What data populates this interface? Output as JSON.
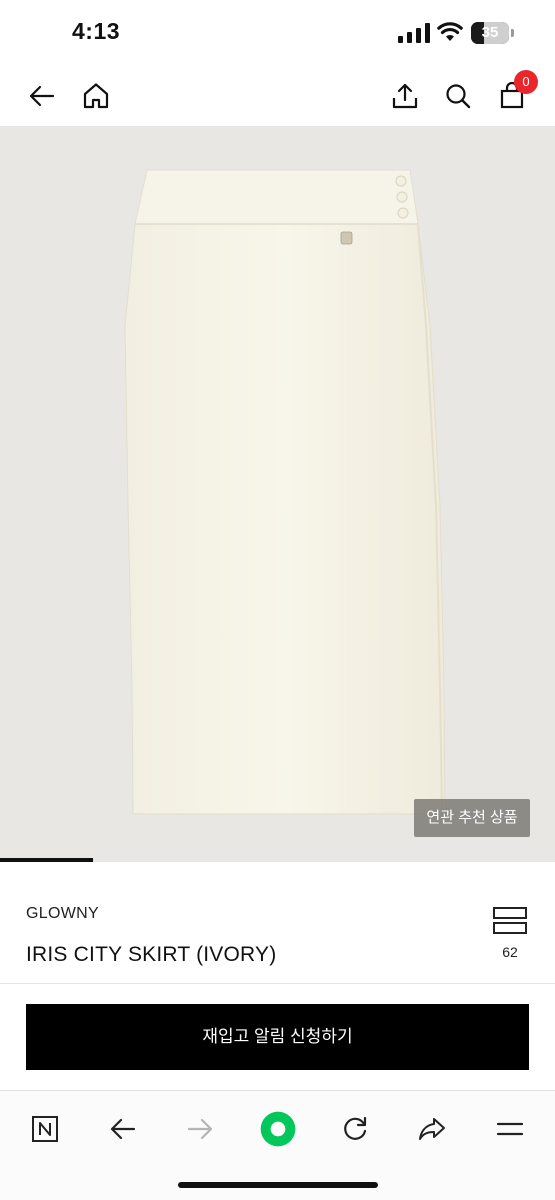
{
  "status_bar": {
    "time": "4:13",
    "battery_level": "35",
    "icons": [
      "signal-icon",
      "wifi-icon",
      "battery-icon"
    ]
  },
  "top_nav": {
    "icons": [
      "back-arrow-icon",
      "home-icon",
      "share-icon",
      "search-icon",
      "shopping-bag-icon"
    ],
    "cart_count": "0",
    "badge_color": "#e8262b"
  },
  "hero": {
    "related_products_label": "연관 추천 상품",
    "image_progress": 0.167,
    "background_color": "#e9e7e3"
  },
  "product": {
    "brand": "GLOWNY",
    "name": "IRIS CITY SKIRT (IVORY)",
    "like_count": "62",
    "like_icon": "wishlist-stack-icon"
  },
  "cta": {
    "restock_label": "재입고 알림 신청하기",
    "background_color": "#000000"
  },
  "browser_toolbar": {
    "icons": [
      "naver-n-icon",
      "back-arrow-icon",
      "forward-arrow-icon",
      "green-dot-home-icon",
      "refresh-icon",
      "share-arrow-icon",
      "menu-icon"
    ],
    "accent_color": "#03c75a"
  }
}
